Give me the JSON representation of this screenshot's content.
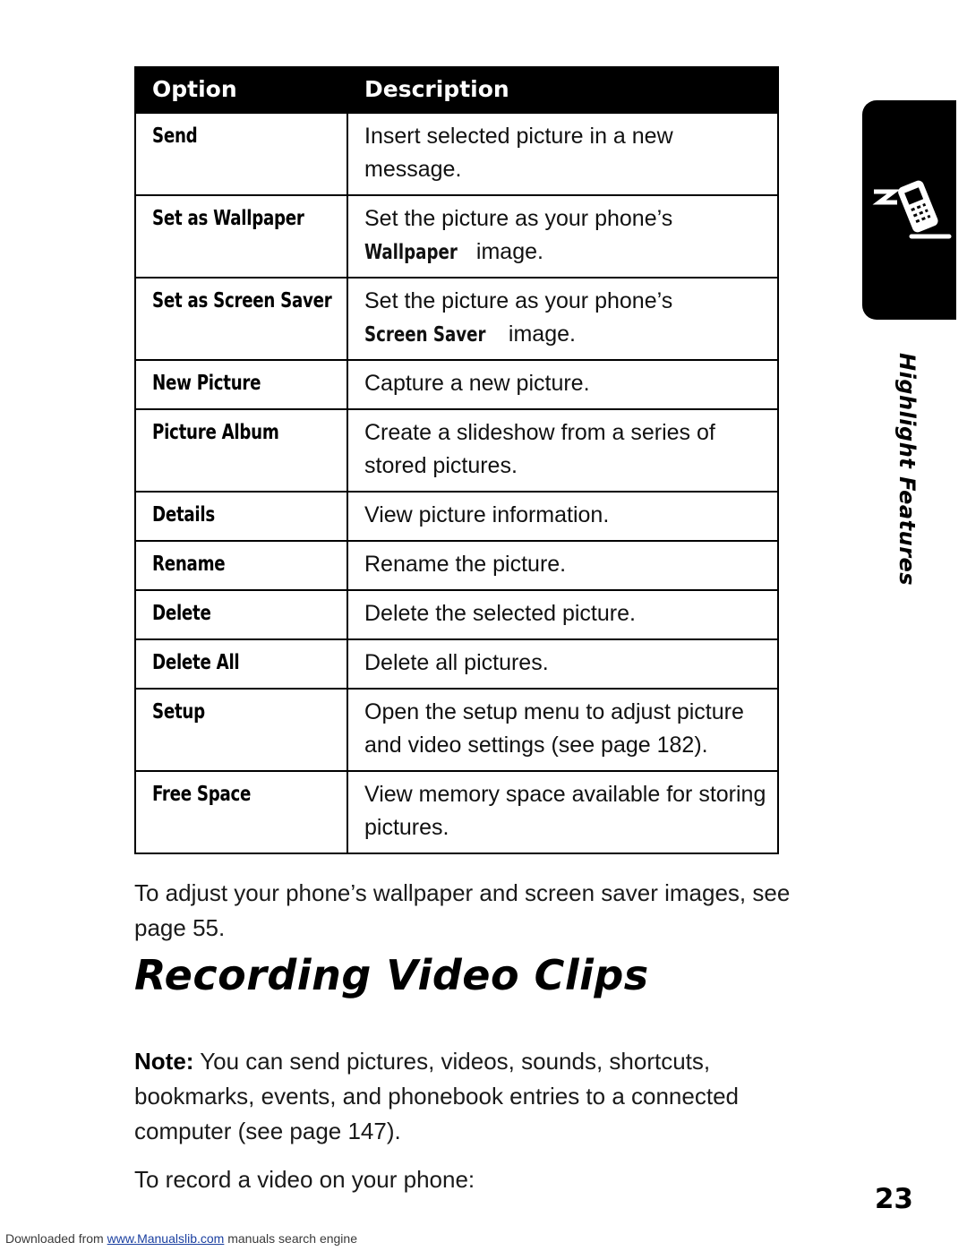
{
  "table": {
    "headers": [
      "Option",
      "Description"
    ],
    "rows": [
      {
        "option": "Send",
        "desc_pre": "Insert selected picture in a new message.",
        "emph": "",
        "desc_post": ""
      },
      {
        "option": "Set as Wallpaper",
        "desc_pre": "Set the picture as your phone’s ",
        "emph": "Wallpaper",
        "desc_post": " image."
      },
      {
        "option": "Set as Screen Saver",
        "desc_pre": "Set the picture as your phone’s ",
        "emph": "Screen Saver",
        "desc_post": " image."
      },
      {
        "option": "New Picture",
        "desc_pre": "Capture a new picture.",
        "emph": "",
        "desc_post": ""
      },
      {
        "option": "Picture Album",
        "desc_pre": "Create a slideshow from a series of stored pictures.",
        "emph": "",
        "desc_post": ""
      },
      {
        "option": "Details",
        "desc_pre": "View picture information.",
        "emph": "",
        "desc_post": ""
      },
      {
        "option": "Rename",
        "desc_pre": "Rename the picture.",
        "emph": "",
        "desc_post": ""
      },
      {
        "option": "Delete",
        "desc_pre": "Delete the selected picture.",
        "emph": "",
        "desc_post": ""
      },
      {
        "option": "Delete All",
        "desc_pre": "Delete all pictures.",
        "emph": "",
        "desc_post": ""
      },
      {
        "option": "Setup",
        "desc_pre": "Open the setup menu to adjust picture and video settings (see page 182).",
        "emph": "",
        "desc_post": ""
      },
      {
        "option": "Free Space",
        "desc_pre": "View memory space available for storing pictures.",
        "emph": "",
        "desc_post": ""
      }
    ]
  },
  "body": {
    "para_adjust": "To adjust your phone’s wallpaper and screen saver images, see page 55.",
    "section_title": "Recording Video Clips",
    "note_label": "Note:",
    "note_text": " You can send pictures, videos, sounds, shortcuts, bookmarks, events, and phonebook entries to a connected computer (see page 147).",
    "para_record": "To record a video on your phone:"
  },
  "side_tab": {
    "label": "Highlight Features",
    "icon": "phone-with-motion-lines-icon"
  },
  "page_number": "23",
  "footer": {
    "prefix": "Downloaded from ",
    "link": "www.Manualslib.com",
    "suffix": " manuals search engine"
  }
}
